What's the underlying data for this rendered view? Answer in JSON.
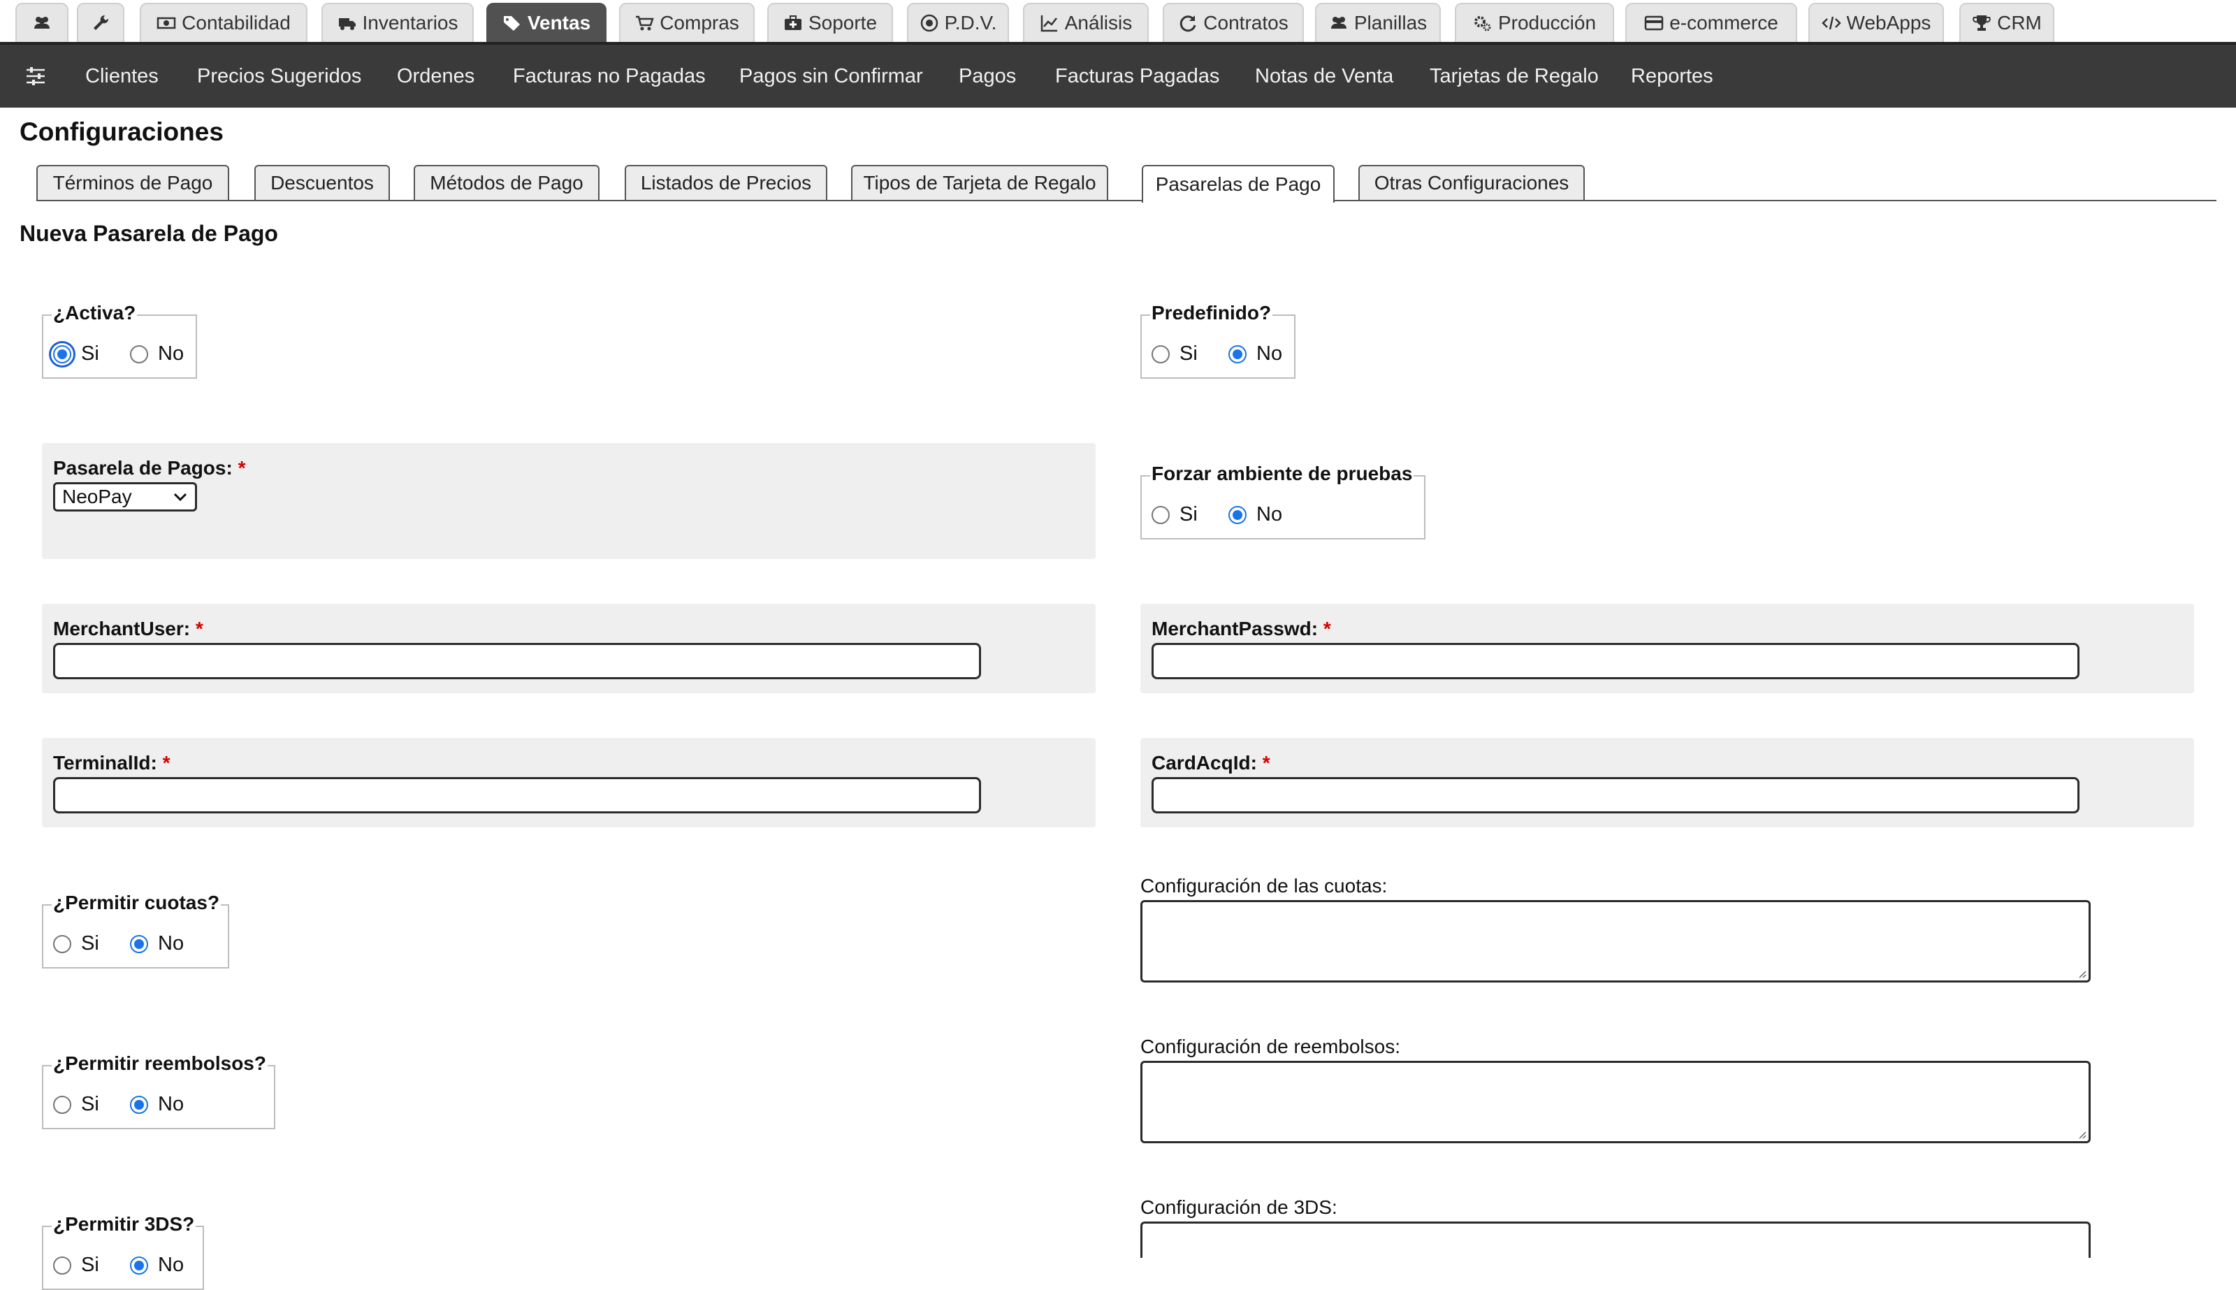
{
  "modules": [
    {
      "label": "",
      "icon": "users-icon",
      "active": false
    },
    {
      "label": "",
      "icon": "wrench-icon",
      "active": false
    },
    {
      "label": "Contabilidad",
      "icon": "money-icon",
      "active": false
    },
    {
      "label": "Inventarios",
      "icon": "truck-icon",
      "active": false
    },
    {
      "label": "Ventas",
      "icon": "tags-icon",
      "active": true
    },
    {
      "label": "Compras",
      "icon": "cart-icon",
      "active": false
    },
    {
      "label": "Soporte",
      "icon": "medkit-icon",
      "active": false
    },
    {
      "label": "P.D.V.",
      "icon": "target-icon",
      "active": false
    },
    {
      "label": "Análisis",
      "icon": "line-chart-icon",
      "active": false
    },
    {
      "label": "Contratos",
      "icon": "refresh-icon",
      "active": false
    },
    {
      "label": "Planillas",
      "icon": "users-icon",
      "active": false
    },
    {
      "label": "Producción",
      "icon": "cogs-icon",
      "active": false
    },
    {
      "label": "e-commerce",
      "icon": "credit-card-icon",
      "active": false
    },
    {
      "label": "WebApps",
      "icon": "code-icon",
      "active": false
    },
    {
      "label": "CRM",
      "icon": "trophy-icon",
      "active": false
    }
  ],
  "subnav": [
    "Clientes",
    "Precios Sugeridos",
    "Ordenes",
    "Facturas no Pagadas",
    "Pagos sin Confirmar",
    "Pagos",
    "Facturas Pagadas",
    "Notas de Venta",
    "Tarjetas de Regalo",
    "Reportes"
  ],
  "page_title": "Configuraciones",
  "settings_tabs": [
    "Términos de Pago",
    "Descuentos",
    "Métodos de Pago",
    "Listados de Precios",
    "Tipos de Tarjeta de Regalo",
    "Pasarelas de Pago",
    "Otras Configuraciones"
  ],
  "active_settings_tab": "Pasarelas de Pago",
  "section_title": "Nueva Pasarela de Pago",
  "options": {
    "yes": "Si",
    "no": "No"
  },
  "form": {
    "activa": {
      "legend": "¿Activa?",
      "value": "Si"
    },
    "predefinido": {
      "legend": "Predefinido?",
      "value": "No"
    },
    "pasarela": {
      "label": "Pasarela de Pagos:",
      "value": "NeoPay"
    },
    "forzar_pruebas": {
      "legend": "Forzar ambiente de pruebas",
      "value": "No"
    },
    "merchant_user": {
      "label": "MerchantUser:",
      "value": ""
    },
    "merchant_passwd": {
      "label": "MerchantPasswd:",
      "value": ""
    },
    "terminal_id": {
      "label": "TerminalId:",
      "value": ""
    },
    "card_acq_id": {
      "label": "CardAcqId:",
      "value": ""
    },
    "permitir_cuotas": {
      "legend": "¿Permitir cuotas?",
      "value": "No"
    },
    "config_cuotas": {
      "label": "Configuración de las cuotas:",
      "value": ""
    },
    "permitir_reembolsos": {
      "legend": "¿Permitir reembolsos?",
      "value": "No"
    },
    "config_reembolsos": {
      "label": "Configuración de reembolsos:",
      "value": ""
    },
    "permitir_3ds": {
      "legend": "¿Permitir 3DS?",
      "value": "No"
    },
    "config_3ds": {
      "label": "Configuración de 3DS:",
      "value": ""
    }
  },
  "required_mark": "*",
  "colors": {
    "active_tab": "#515151",
    "subnav": "#3a3a3a",
    "panel": "#efefef",
    "radio_checked": "#1a73e8",
    "required": "#d60000"
  }
}
